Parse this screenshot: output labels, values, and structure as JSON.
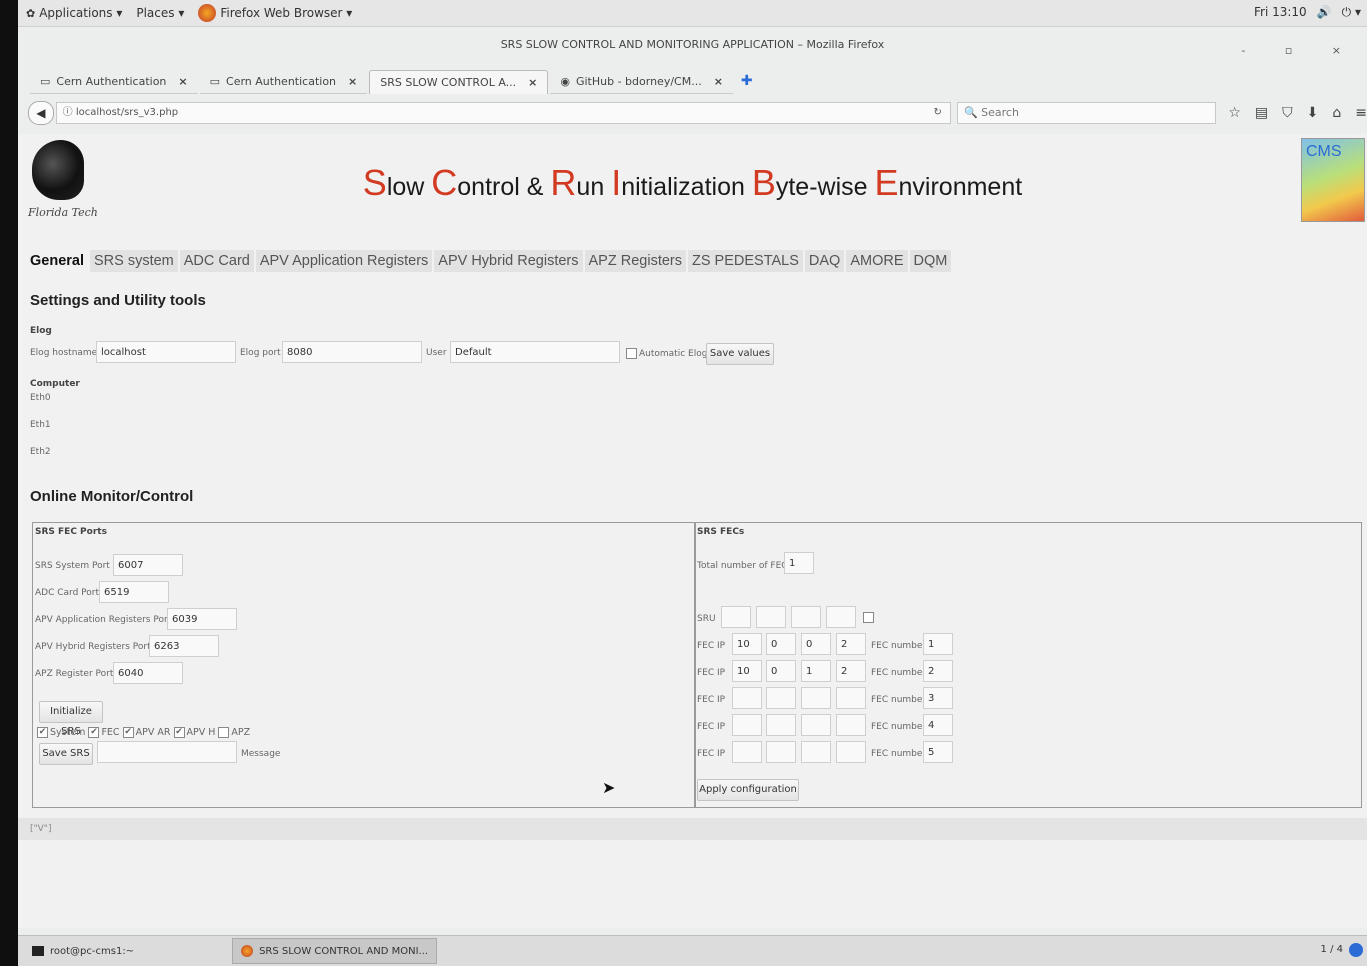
{
  "gnome": {
    "applications": "Applications ▾",
    "places": "Places ▾",
    "browser": "Firefox Web Browser ▾",
    "clock": "Fri 13:10",
    "volume": "🔊",
    "power": "⏻ ▾"
  },
  "window": {
    "title": "SRS SLOW CONTROL AND MONITORING APPLICATION – Mozilla Firefox",
    "controls": "- ▫ ×"
  },
  "tabs": [
    {
      "label": "Cern Authentication"
    },
    {
      "label": "Cern Authentication"
    },
    {
      "label": "SRS SLOW CONTROL A..."
    },
    {
      "label": "GitHub - bdorney/CM..."
    }
  ],
  "nav": {
    "url": "localhost/srs_v3.php",
    "search_placeholder": "Search",
    "icons": [
      "star-icon",
      "reader-icon",
      "pocket-icon",
      "download-icon",
      "home-icon",
      "menu-icon"
    ]
  },
  "logos": {
    "left_text": "Florida Tech",
    "right_text": "CMS"
  },
  "banner": {
    "w1c": "S",
    "w1r": "low",
    "w2c": "C",
    "w2r": "ontrol",
    "amp": "&",
    "w3c": "R",
    "w3r": "un",
    "w4c": "I",
    "w4r": "nitialization",
    "w5c": "B",
    "w5r": "yte-wise",
    "w6c": "E",
    "w6r": "nvironment"
  },
  "page_tabs": [
    "General",
    "SRS system",
    "ADC Card",
    "APV Application Registers",
    "APV Hybrid Registers",
    "APZ Registers",
    "ZS PEDESTALS",
    "DAQ",
    "AMORE",
    "DQM"
  ],
  "settings": {
    "title": "Settings and Utility tools",
    "elog_label": "Elog",
    "hostname_label": "Elog hostname",
    "hostname_value": "localhost",
    "port_label": "Elog port",
    "port_value": "8080",
    "user_label": "User",
    "user_value": "Default",
    "auto_elog": "Automatic Elog",
    "save_values": "Save values",
    "computer_label": "Computer",
    "eth0": "Eth0",
    "eth1": "Eth1",
    "eth2": "Eth2"
  },
  "online": {
    "title": "Online Monitor/Control",
    "ports_title": "SRS FEC Ports",
    "srs_port_label": "SRS System Port",
    "srs_port": "6007",
    "adc_port_label": "ADC Card Port",
    "adc_port": "6519",
    "apv_app_label": "APV Application Registers Port",
    "apv_app_port": "6039",
    "apv_hyb_label": "APV Hybrid Registers Port",
    "apv_hyb_port": "6263",
    "apz_label": "APZ Register Port",
    "apz_port": "6040",
    "init_btn": "Initialize SRS",
    "cb_system": "System",
    "cb_fec": "FEC",
    "cb_apvar": "APV AR",
    "cb_apvh": "APV H",
    "cb_apz": "APZ",
    "save_btn": "Save SRS",
    "message_label": "Message"
  },
  "fecs": {
    "title": "SRS FECs",
    "total_label": "Total number of FECs",
    "total_value": "1",
    "sru_label": "SRU",
    "fec_ip_label": "FEC IP",
    "fec_num_label": "FEC number",
    "rows": [
      {
        "ip": [
          "10",
          "0",
          "0",
          "2"
        ],
        "num": "1"
      },
      {
        "ip": [
          "10",
          "0",
          "1",
          "2"
        ],
        "num": "2"
      },
      {
        "ip": [
          "",
          "",
          "",
          ""
        ],
        "num": "3"
      },
      {
        "ip": [
          "",
          "",
          "",
          ""
        ],
        "num": "4"
      },
      {
        "ip": [
          "",
          "",
          "",
          ""
        ],
        "num": "5"
      }
    ],
    "apply_btn": "Apply configuration"
  },
  "status_strip": "[\"V\"]",
  "taskbar": {
    "terminal": "root@pc-cms1:~",
    "firefox": "SRS SLOW CONTROL AND MONI...",
    "pager": "1 / 4"
  }
}
